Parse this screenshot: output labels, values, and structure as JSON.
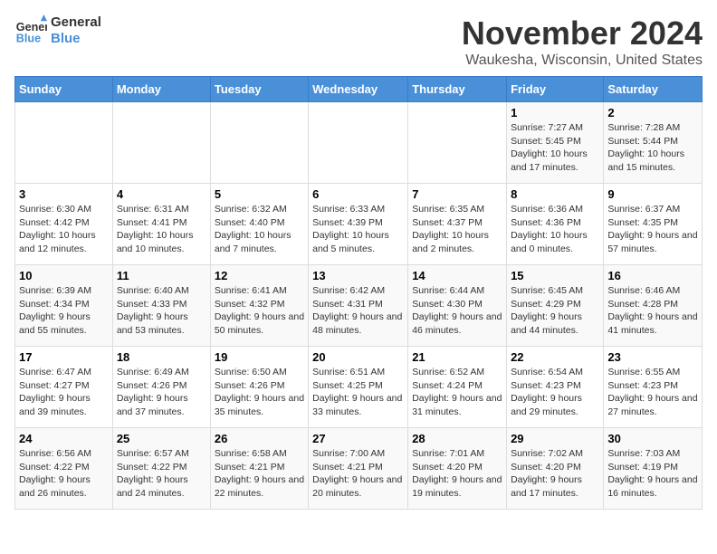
{
  "header": {
    "logo_line1": "General",
    "logo_line2": "Blue",
    "month_year": "November 2024",
    "location": "Waukesha, Wisconsin, United States"
  },
  "days_of_week": [
    "Sunday",
    "Monday",
    "Tuesday",
    "Wednesday",
    "Thursday",
    "Friday",
    "Saturday"
  ],
  "weeks": [
    [
      {
        "day": "",
        "info": ""
      },
      {
        "day": "",
        "info": ""
      },
      {
        "day": "",
        "info": ""
      },
      {
        "day": "",
        "info": ""
      },
      {
        "day": "",
        "info": ""
      },
      {
        "day": "1",
        "info": "Sunrise: 7:27 AM\nSunset: 5:45 PM\nDaylight: 10 hours and 17 minutes."
      },
      {
        "day": "2",
        "info": "Sunrise: 7:28 AM\nSunset: 5:44 PM\nDaylight: 10 hours and 15 minutes."
      }
    ],
    [
      {
        "day": "3",
        "info": "Sunrise: 6:30 AM\nSunset: 4:42 PM\nDaylight: 10 hours and 12 minutes."
      },
      {
        "day": "4",
        "info": "Sunrise: 6:31 AM\nSunset: 4:41 PM\nDaylight: 10 hours and 10 minutes."
      },
      {
        "day": "5",
        "info": "Sunrise: 6:32 AM\nSunset: 4:40 PM\nDaylight: 10 hours and 7 minutes."
      },
      {
        "day": "6",
        "info": "Sunrise: 6:33 AM\nSunset: 4:39 PM\nDaylight: 10 hours and 5 minutes."
      },
      {
        "day": "7",
        "info": "Sunrise: 6:35 AM\nSunset: 4:37 PM\nDaylight: 10 hours and 2 minutes."
      },
      {
        "day": "8",
        "info": "Sunrise: 6:36 AM\nSunset: 4:36 PM\nDaylight: 10 hours and 0 minutes."
      },
      {
        "day": "9",
        "info": "Sunrise: 6:37 AM\nSunset: 4:35 PM\nDaylight: 9 hours and 57 minutes."
      }
    ],
    [
      {
        "day": "10",
        "info": "Sunrise: 6:39 AM\nSunset: 4:34 PM\nDaylight: 9 hours and 55 minutes."
      },
      {
        "day": "11",
        "info": "Sunrise: 6:40 AM\nSunset: 4:33 PM\nDaylight: 9 hours and 53 minutes."
      },
      {
        "day": "12",
        "info": "Sunrise: 6:41 AM\nSunset: 4:32 PM\nDaylight: 9 hours and 50 minutes."
      },
      {
        "day": "13",
        "info": "Sunrise: 6:42 AM\nSunset: 4:31 PM\nDaylight: 9 hours and 48 minutes."
      },
      {
        "day": "14",
        "info": "Sunrise: 6:44 AM\nSunset: 4:30 PM\nDaylight: 9 hours and 46 minutes."
      },
      {
        "day": "15",
        "info": "Sunrise: 6:45 AM\nSunset: 4:29 PM\nDaylight: 9 hours and 44 minutes."
      },
      {
        "day": "16",
        "info": "Sunrise: 6:46 AM\nSunset: 4:28 PM\nDaylight: 9 hours and 41 minutes."
      }
    ],
    [
      {
        "day": "17",
        "info": "Sunrise: 6:47 AM\nSunset: 4:27 PM\nDaylight: 9 hours and 39 minutes."
      },
      {
        "day": "18",
        "info": "Sunrise: 6:49 AM\nSunset: 4:26 PM\nDaylight: 9 hours and 37 minutes."
      },
      {
        "day": "19",
        "info": "Sunrise: 6:50 AM\nSunset: 4:26 PM\nDaylight: 9 hours and 35 minutes."
      },
      {
        "day": "20",
        "info": "Sunrise: 6:51 AM\nSunset: 4:25 PM\nDaylight: 9 hours and 33 minutes."
      },
      {
        "day": "21",
        "info": "Sunrise: 6:52 AM\nSunset: 4:24 PM\nDaylight: 9 hours and 31 minutes."
      },
      {
        "day": "22",
        "info": "Sunrise: 6:54 AM\nSunset: 4:23 PM\nDaylight: 9 hours and 29 minutes."
      },
      {
        "day": "23",
        "info": "Sunrise: 6:55 AM\nSunset: 4:23 PM\nDaylight: 9 hours and 27 minutes."
      }
    ],
    [
      {
        "day": "24",
        "info": "Sunrise: 6:56 AM\nSunset: 4:22 PM\nDaylight: 9 hours and 26 minutes."
      },
      {
        "day": "25",
        "info": "Sunrise: 6:57 AM\nSunset: 4:22 PM\nDaylight: 9 hours and 24 minutes."
      },
      {
        "day": "26",
        "info": "Sunrise: 6:58 AM\nSunset: 4:21 PM\nDaylight: 9 hours and 22 minutes."
      },
      {
        "day": "27",
        "info": "Sunrise: 7:00 AM\nSunset: 4:21 PM\nDaylight: 9 hours and 20 minutes."
      },
      {
        "day": "28",
        "info": "Sunrise: 7:01 AM\nSunset: 4:20 PM\nDaylight: 9 hours and 19 minutes."
      },
      {
        "day": "29",
        "info": "Sunrise: 7:02 AM\nSunset: 4:20 PM\nDaylight: 9 hours and 17 minutes."
      },
      {
        "day": "30",
        "info": "Sunrise: 7:03 AM\nSunset: 4:19 PM\nDaylight: 9 hours and 16 minutes."
      }
    ]
  ]
}
